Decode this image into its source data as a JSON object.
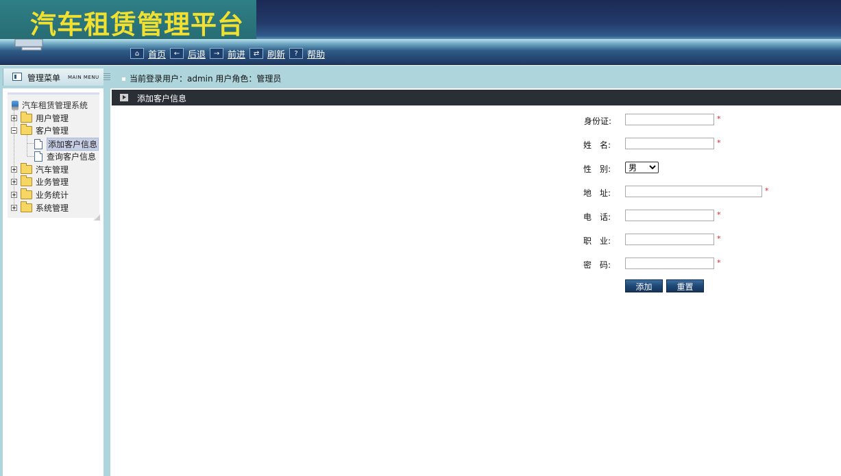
{
  "app": {
    "title": "汽车租赁管理平台"
  },
  "toolbar": {
    "items": [
      {
        "label": "首页",
        "icon": "home-icon"
      },
      {
        "label": "后退",
        "icon": "back-arrow-icon"
      },
      {
        "label": "前进",
        "icon": "forward-arrow-icon"
      },
      {
        "label": "刷新",
        "icon": "refresh-icon"
      },
      {
        "label": "帮助",
        "icon": "help-icon"
      }
    ]
  },
  "menu": {
    "title": "管理菜单",
    "title_en": "MAIN MENU"
  },
  "user": {
    "text": "当前登录用户：admin  用户角色：管理员"
  },
  "tree": {
    "root": "汽车租赁管理系统",
    "nodes": {
      "user_mgmt": "用户管理",
      "customer_mgmt": "客户管理",
      "add_customer": "添加客户信息",
      "query_customer": "查询客户信息",
      "car_mgmt": "汽车管理",
      "business_mgmt": "业务管理",
      "business_stats": "业务统计",
      "system_mgmt": "系统管理"
    }
  },
  "content": {
    "title": "添加客户信息"
  },
  "form": {
    "id_label": "身份证:",
    "name_label": "姓　名:",
    "gender_label": "性　别:",
    "gender_value": "男",
    "address_label": "地　址:",
    "phone_label": "电　话:",
    "job_label": "职　业:",
    "password_label": "密　码:",
    "required_mark": "*",
    "add_button": "添加",
    "reset_button": "重置"
  }
}
